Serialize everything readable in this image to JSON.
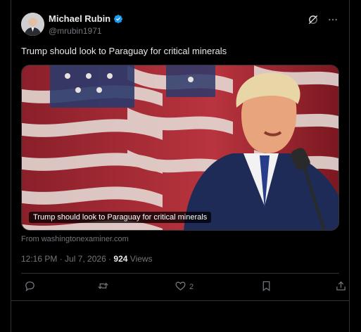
{
  "author": {
    "name": "Michael Rubin",
    "handle": "@mrubin1971",
    "verified": true
  },
  "tweet": {
    "text": "Trump should look to Paraguay for critical minerals"
  },
  "card": {
    "caption": "Trump should look to Paraguay for critical minerals",
    "source": "From washingtonexaminer.com"
  },
  "meta": {
    "timestamp": "12:16 PM · Jul 7, 2026",
    "separator": " · ",
    "views_count": "924",
    "views_label": " Views"
  },
  "actions": {
    "reply_count": "",
    "retweet_count": "",
    "like_count": "2",
    "bookmark_count": ""
  },
  "icons": {
    "verified": "verified-badge-icon",
    "grok": "grok-icon",
    "more": "more-icon",
    "reply": "reply-icon",
    "retweet": "retweet-icon",
    "like": "heart-icon",
    "bookmark": "bookmark-icon",
    "share": "share-icon"
  },
  "colors": {
    "background": "#000000",
    "text": "#e7e9ea",
    "muted": "#71767b",
    "border": "#2f3336",
    "verified": "#1d9bf0"
  }
}
